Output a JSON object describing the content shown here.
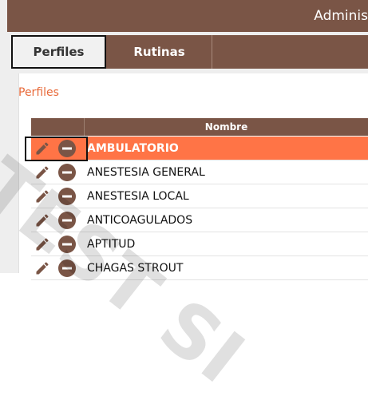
{
  "header": {
    "title": "Adminis"
  },
  "tabs": [
    {
      "label": "Perfiles",
      "active": true
    },
    {
      "label": "Rutinas",
      "active": false
    }
  ],
  "section": {
    "title": "Perfiles"
  },
  "grid": {
    "columns": [
      "Nombre"
    ],
    "rows": [
      {
        "name": "AMBULATORIO",
        "selected": true
      },
      {
        "name": "ANESTESIA GENERAL",
        "selected": false
      },
      {
        "name": "ANESTESIA LOCAL",
        "selected": false
      },
      {
        "name": "ANTICOAGULADOS",
        "selected": false
      },
      {
        "name": "APTITUD",
        "selected": false
      },
      {
        "name": "CHAGAS STROUT",
        "selected": false
      }
    ]
  },
  "watermark": "TEST SI",
  "colors": {
    "brand_brown": "#7a5546",
    "accent_orange": "#ff7446",
    "section_title": "#e86a3a"
  },
  "icons": {
    "edit": "pencil-icon",
    "remove": "remove-icon"
  }
}
